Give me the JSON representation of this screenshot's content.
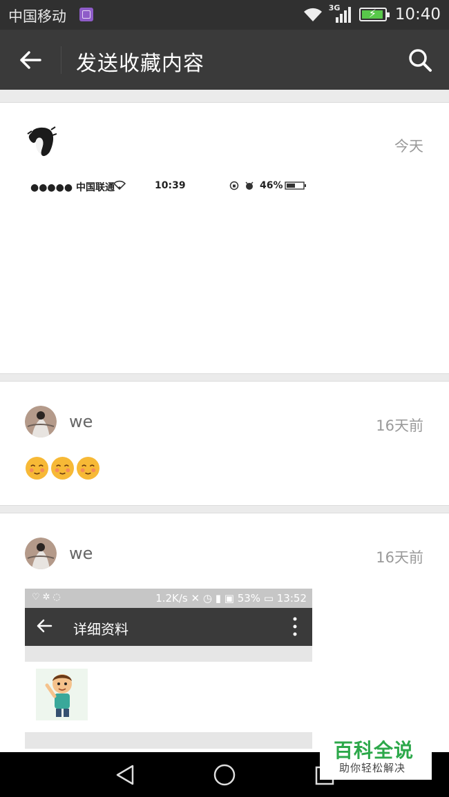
{
  "status_bar": {
    "carrier": "中国移动",
    "network": "3G",
    "time": "10:40"
  },
  "title_bar": {
    "title": "发送收藏内容"
  },
  "items": [
    {
      "time": "今天",
      "mini_status": {
        "carrier": "●●●●● 中国联通",
        "time": "10:39",
        "battery": "46%"
      }
    },
    {
      "sender": "we",
      "time": "16天前",
      "emoji_count": 3
    },
    {
      "sender": "we",
      "time": "16天前",
      "screenshot": {
        "speed": "1.2K/s",
        "battery": "53%",
        "time": "13:52",
        "title": "详细资料"
      }
    }
  ],
  "watermark": {
    "title": "百科全说",
    "subtitle": "助你轻松解决"
  },
  "colors": {
    "titlebar_bg": "#3a3a3a",
    "statusbar_bg": "#303030",
    "battery_green": "#58c84a",
    "watermark_green": "#2ca84a"
  }
}
